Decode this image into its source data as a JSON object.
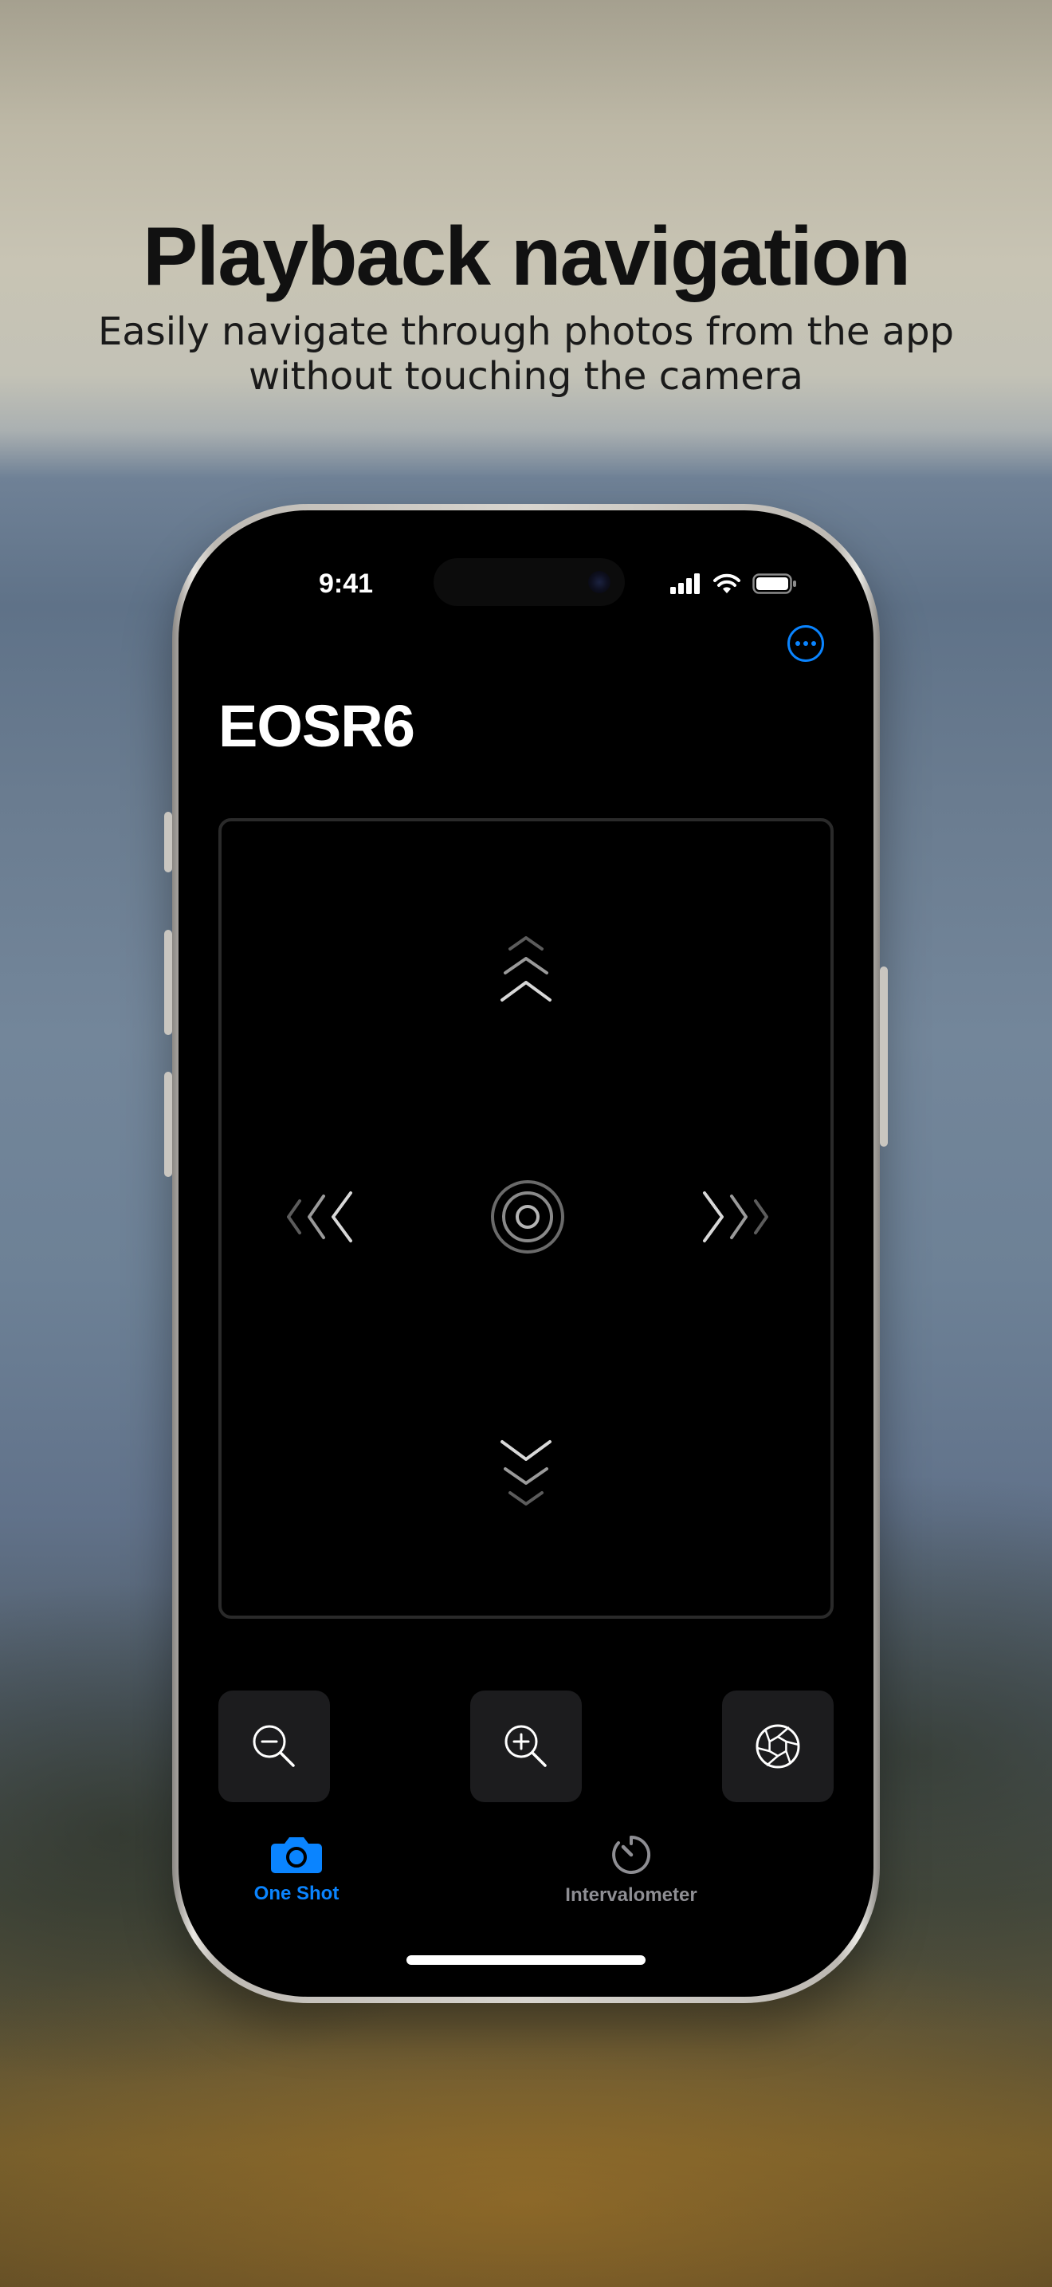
{
  "promo": {
    "headline": "Playback navigation",
    "subline_1": "Easily navigate through photos from the app",
    "subline_2": "without touching the camera"
  },
  "status_bar": {
    "time": "9:41",
    "icons": [
      "cellular-signal-icon",
      "wifi-icon",
      "battery-icon"
    ]
  },
  "header": {
    "title": "EOSR6",
    "more_icon": "ellipsis-circle-icon"
  },
  "playback_pad": {
    "controls": [
      "up-chevrons-icon",
      "left-chevrons-icon",
      "center-target-icon",
      "right-chevrons-icon",
      "down-chevrons-icon"
    ]
  },
  "toolbar": {
    "buttons": [
      "zoom-out-icon",
      "zoom-in-icon",
      "aperture-icon"
    ]
  },
  "tabs": [
    {
      "label": "One Shot",
      "icon": "camera-icon",
      "active": true
    },
    {
      "label": "Intervalometer",
      "icon": "timer-icon",
      "active": false
    }
  ],
  "colors": {
    "accent": "#0a84ff",
    "tab_inactive": "#8e8e93",
    "screen_background": "#000000",
    "button_background": "#1c1c1e"
  }
}
